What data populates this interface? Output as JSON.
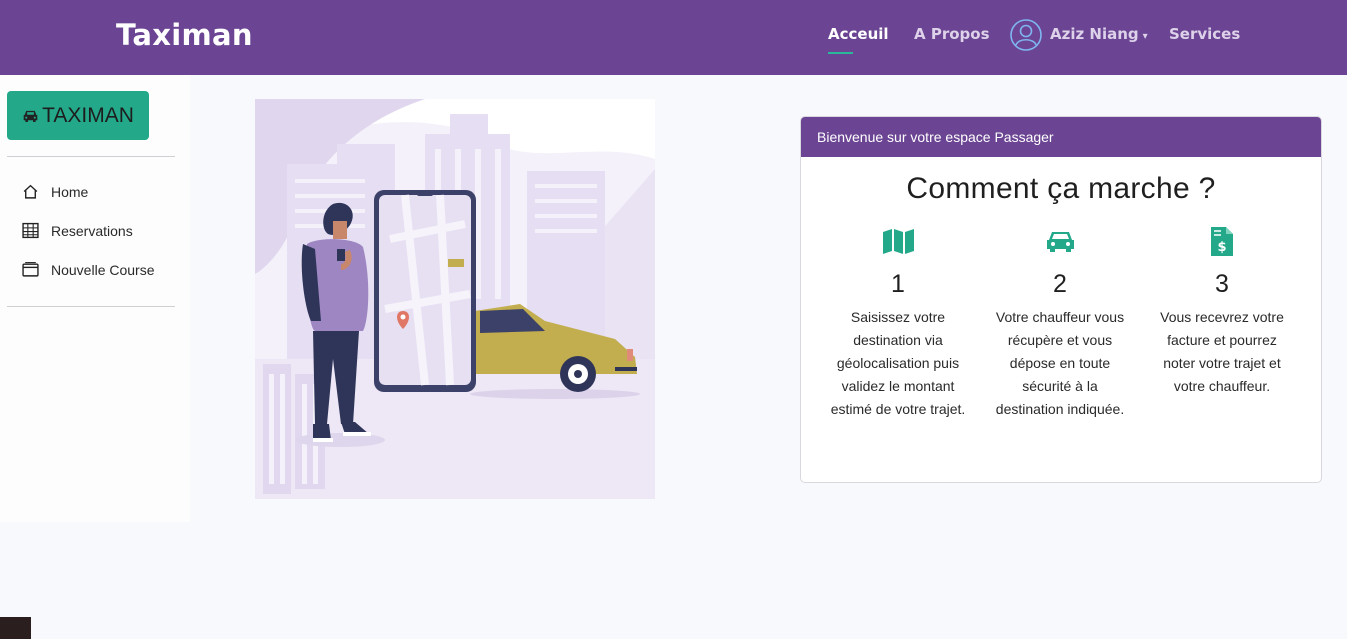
{
  "navbar": {
    "brand": "Taximan",
    "items": [
      {
        "label": "Acceuil",
        "active": true
      },
      {
        "label": "A Propos"
      },
      {
        "label": "Aziz Niang"
      },
      {
        "label": "Services"
      }
    ],
    "colors": {
      "background": "#6b4593",
      "accent": "#2ab89a"
    }
  },
  "sidebar": {
    "logo_text": "TAXIMAN",
    "items": [
      {
        "label": "Home",
        "icon": "home-icon"
      },
      {
        "label": "Reservations",
        "icon": "table-icon"
      },
      {
        "label": "Nouvelle Course",
        "icon": "window-icon"
      }
    ]
  },
  "card": {
    "header": "Bienvenue sur votre espace Passager",
    "title": "Comment ça marche ?",
    "steps": [
      {
        "number": "1",
        "icon": "map-icon",
        "text": "Saisissez votre destination via géolocalisation puis validez le montant estimé de votre trajet."
      },
      {
        "number": "2",
        "icon": "car-icon",
        "text": "Votre chauffeur vous récupère et vous dépose en toute sécurité à la destination indiquée."
      },
      {
        "number": "3",
        "icon": "invoice-dollar-icon",
        "text": "Vous recevrez votre facture et pourrez noter votre trajet et votre chauffeur."
      }
    ]
  }
}
